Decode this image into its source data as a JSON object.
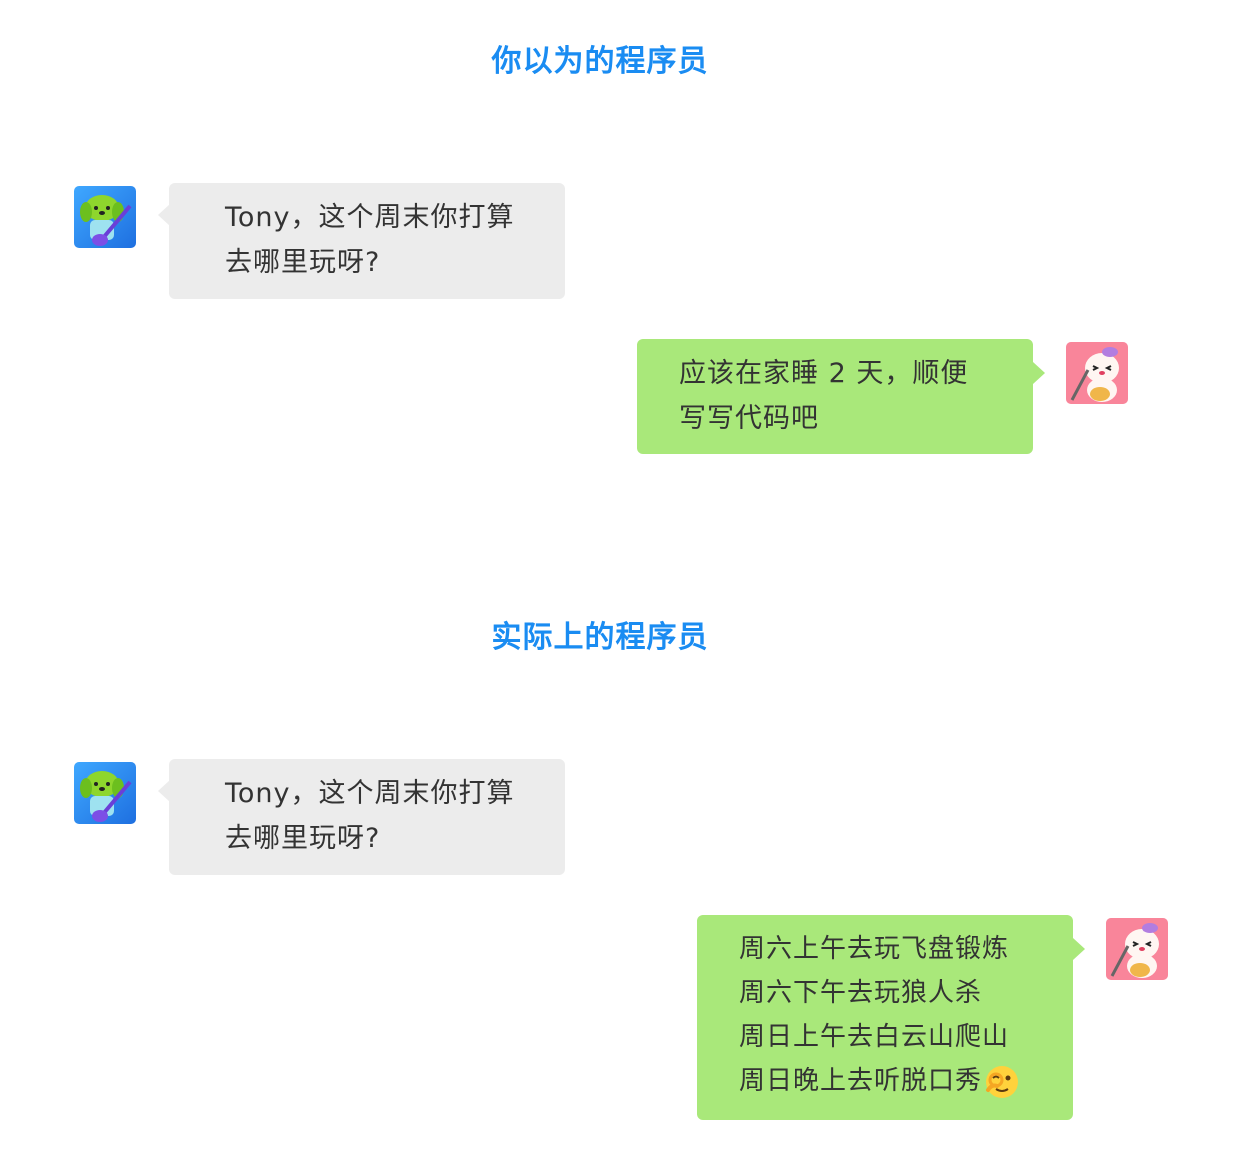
{
  "sections": [
    {
      "title": "你以为的程序员",
      "incoming": {
        "avatar": "dog-playing-guitar-avatar",
        "lines": [
          "Tony，这个周末你打算",
          "去哪里玩呀?"
        ]
      },
      "outgoing": {
        "avatar": "bunny-with-guitar-avatar",
        "lines": [
          "应该在家睡 2 天，顺便",
          "写写代码吧"
        ]
      }
    },
    {
      "title": "实际上的程序员",
      "incoming": {
        "avatar": "dog-playing-guitar-avatar",
        "lines": [
          "Tony，这个周末你打算",
          "去哪里玩呀?"
        ]
      },
      "outgoing": {
        "avatar": "bunny-with-guitar-avatar",
        "lines": [
          "周六上午去玩飞盘锻炼",
          "周六下午去玩狼人杀",
          "周日上午去白云山爬山",
          "周日晚上去听脱口秀"
        ],
        "trailing_emoji": "face-with-finger-ok-emoji"
      }
    }
  ],
  "colors": {
    "title": "#1a8cf2",
    "incoming_bubble": "#ececec",
    "outgoing_bubble": "#a9e87a",
    "text": "#333333"
  }
}
